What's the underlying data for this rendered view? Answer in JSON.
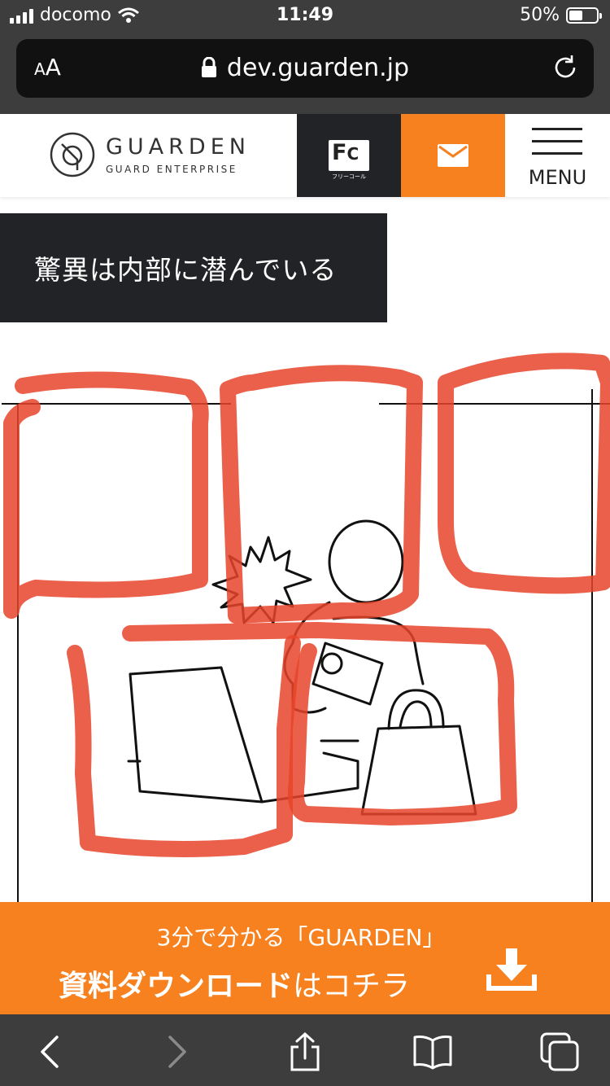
{
  "status_bar": {
    "carrier": "docomo",
    "time": "11:49",
    "battery_percent": "50%",
    "battery_level": 0.5
  },
  "browser": {
    "text_size_label": "AA",
    "url": "dev.guarden.jp"
  },
  "header": {
    "logo_title": "GUARDEN",
    "logo_subtitle": "GUARD ENTERPRISE",
    "freecall_label": "フリーコール",
    "menu_label": "MENU"
  },
  "main": {
    "heading": "驚異は内部に潜んでいる"
  },
  "download_banner": {
    "line1": "3分で分かる「GUARDEN」",
    "line2_bold": "資料ダウンロード",
    "line2_rest": "はコチラ"
  },
  "colors": {
    "accent": "#f7811f",
    "dark": "#222326",
    "highlight_red": "#e8442a"
  },
  "icons": [
    "signal-icon",
    "wifi-icon",
    "battery-icon",
    "lock-icon",
    "reload-icon",
    "mail-icon",
    "download-icon",
    "back-icon",
    "forward-icon",
    "share-icon",
    "bookmarks-icon",
    "tabs-icon"
  ]
}
